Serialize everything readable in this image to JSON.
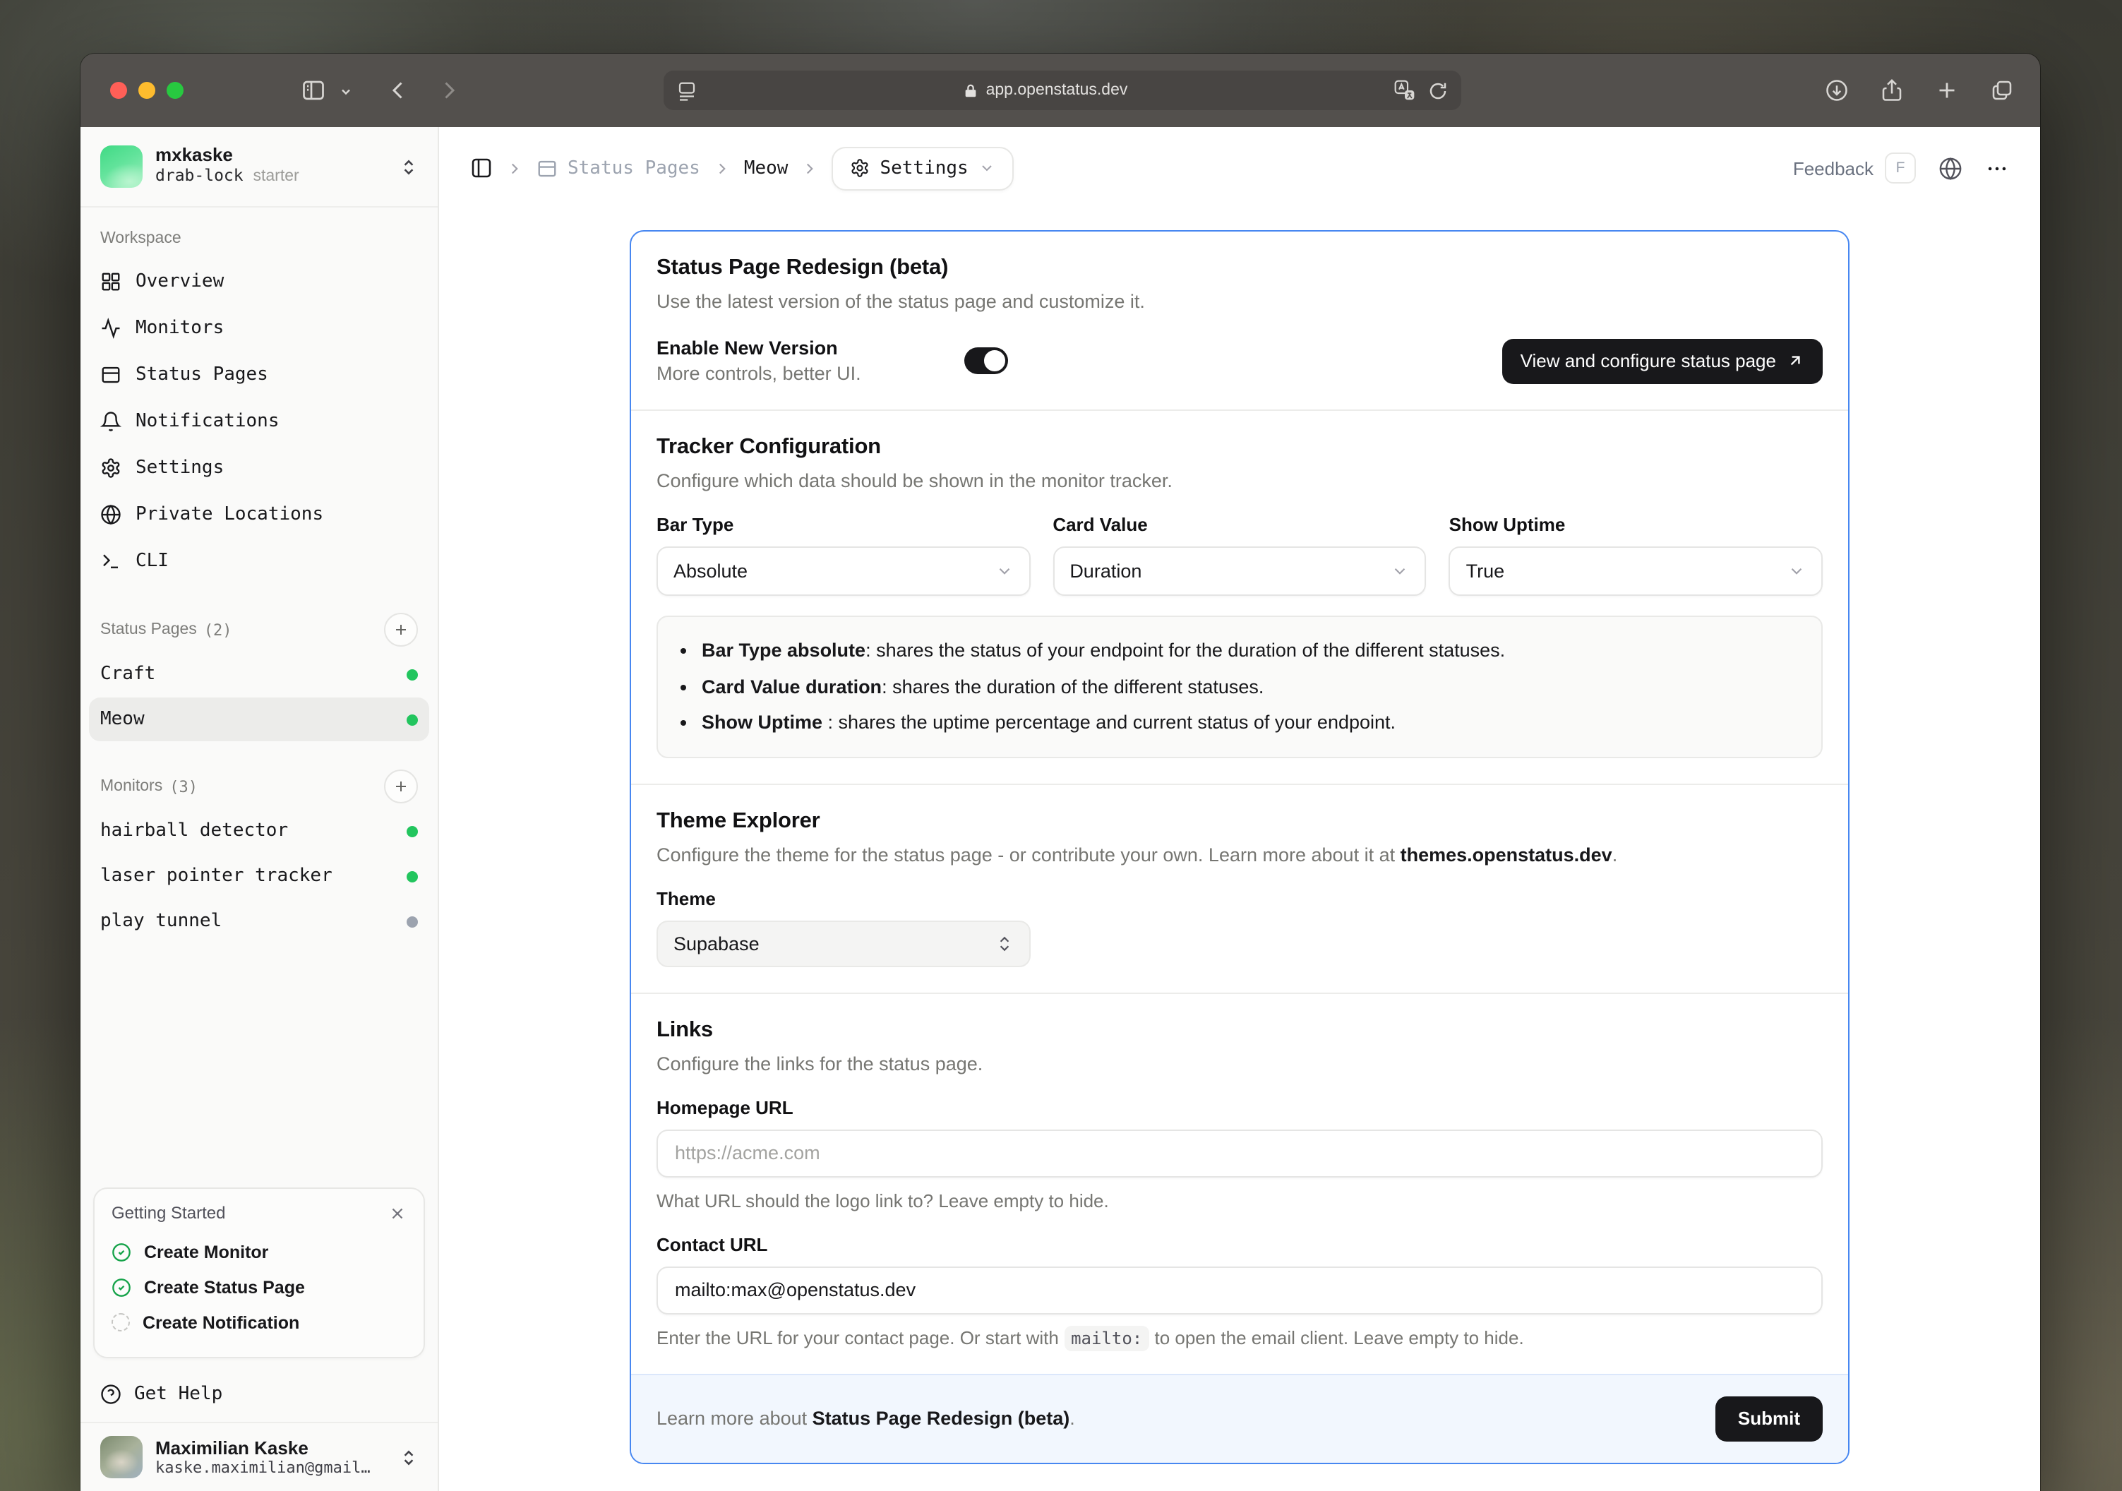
{
  "browser": {
    "url": "app.openstatus.dev"
  },
  "workspace": {
    "name": "mxkaske",
    "plan": "drab-lock",
    "plan_suffix": "starter"
  },
  "sidebar": {
    "workspace_label": "Workspace",
    "nav": [
      {
        "label": "Overview"
      },
      {
        "label": "Monitors"
      },
      {
        "label": "Status Pages"
      },
      {
        "label": "Notifications"
      },
      {
        "label": "Settings"
      },
      {
        "label": "Private Locations"
      },
      {
        "label": "CLI"
      }
    ],
    "status_pages": {
      "label": "Status Pages",
      "count": "(2)",
      "items": [
        {
          "name": "Craft",
          "status_color": "#22c55e"
        },
        {
          "name": "Meow",
          "status_color": "#22c55e",
          "selected": true
        }
      ]
    },
    "monitors": {
      "label": "Monitors",
      "count": "(3)",
      "items": [
        {
          "name": "hairball detector",
          "status_color": "#22c55e"
        },
        {
          "name": "laser pointer tracker",
          "status_color": "#22c55e"
        },
        {
          "name": "play tunnel",
          "status_color": "#9ca3af"
        }
      ]
    },
    "getting_started": {
      "title": "Getting Started",
      "items": [
        {
          "label": "Create Monitor",
          "done": true
        },
        {
          "label": "Create Status Page",
          "done": true
        },
        {
          "label": "Create Notification",
          "done": false
        }
      ]
    },
    "get_help": "Get Help",
    "user": {
      "name": "Maximilian Kaske",
      "email": "kaske.maximilian@gmail…"
    }
  },
  "header": {
    "breadcrumb": [
      "Status Pages",
      "Meow",
      "Settings"
    ],
    "feedback": "Feedback",
    "feedback_key": "F"
  },
  "page": {
    "redesign": {
      "title": "Status Page Redesign (beta)",
      "description": "Use the latest version of the status page and customize it.",
      "toggle_label": "Enable New Version",
      "toggle_sublabel": "More controls, better UI.",
      "toggle_state": "on",
      "view_button": "View and configure status page"
    },
    "tracker": {
      "title": "Tracker Configuration",
      "description": "Configure which data should be shown in the monitor tracker.",
      "fields": [
        {
          "label": "Bar Type",
          "value": "Absolute"
        },
        {
          "label": "Card Value",
          "value": "Duration"
        },
        {
          "label": "Show Uptime",
          "value": "True"
        }
      ],
      "notes": [
        {
          "lead": "Bar Type absolute",
          "text": ": shares the status of your endpoint for the duration of the different statuses."
        },
        {
          "lead": "Card Value duration",
          "text": ": shares the duration of the different statuses."
        },
        {
          "lead": "Show Uptime",
          "text": " : shares the uptime percentage and current status of your endpoint."
        }
      ]
    },
    "theme": {
      "title": "Theme Explorer",
      "description_prefix": "Configure the theme for the status page - or contribute your own. Learn more about it at ",
      "description_link": "themes.openstatus.dev",
      "description_suffix": ".",
      "label": "Theme",
      "value": "Supabase"
    },
    "links": {
      "title": "Links",
      "description": "Configure the links for the status page.",
      "homepage_label": "Homepage URL",
      "homepage_placeholder": "https://acme.com",
      "homepage_help": "What URL should the logo link to? Leave empty to hide.",
      "contact_label": "Contact URL",
      "contact_value": "mailto:max@openstatus.dev",
      "contact_help_prefix": "Enter the URL for your contact page. Or start with ",
      "contact_help_code": "mailto:",
      "contact_help_suffix": " to open the email client. Leave empty to hide."
    },
    "footer": {
      "text_prefix": "Learn more about ",
      "text_bold": "Status Page Redesign (beta)",
      "text_suffix": ".",
      "submit": "Submit"
    }
  },
  "colors": {
    "accent_blue": "#4787f1",
    "status_up": "#22c55e",
    "status_inactive": "#9ca3af",
    "traffic_red": "#ff5f57",
    "traffic_yellow": "#febc2e",
    "traffic_green": "#28c840"
  }
}
